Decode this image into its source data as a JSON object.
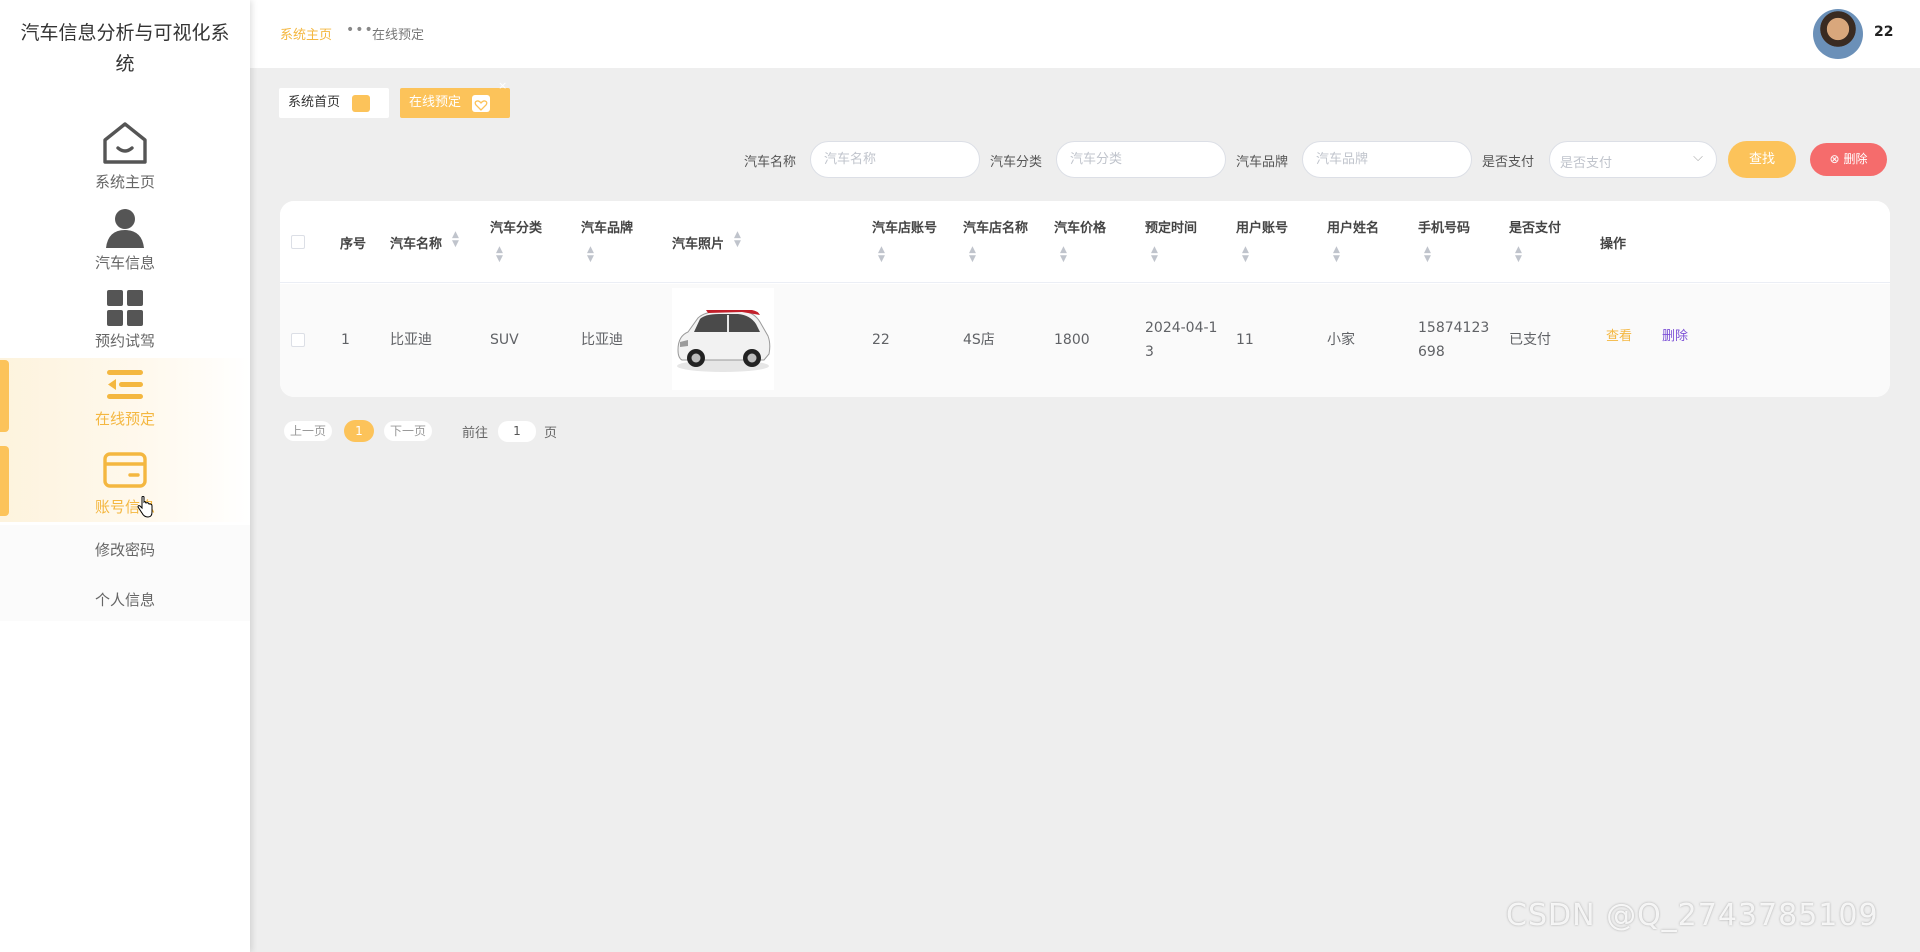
{
  "app": {
    "title": "汽车信息分析与可视化系统"
  },
  "sidebar": {
    "items": [
      {
        "label": "系统主页",
        "icon": "home-icon",
        "active": false
      },
      {
        "label": "汽车信息",
        "icon": "user-icon",
        "active": false
      },
      {
        "label": "预约试驾",
        "icon": "grid-icon",
        "active": false
      },
      {
        "label": "在线预定",
        "icon": "list-indent-icon",
        "active": true
      },
      {
        "label": "账号信息",
        "icon": "card-icon",
        "active": true
      }
    ],
    "submenu": [
      {
        "label": "修改密码"
      },
      {
        "label": "个人信息"
      }
    ]
  },
  "header": {
    "breadcrumb_home": "系统主页",
    "breadcrumb_current": "在线预定",
    "username": "22"
  },
  "tabs": [
    {
      "label": "系统首页"
    },
    {
      "label": "在线预定",
      "close": "×"
    }
  ],
  "search": {
    "fields": [
      {
        "label": "汽车名称",
        "placeholder": "汽车名称"
      },
      {
        "label": "汽车分类",
        "placeholder": "汽车分类"
      },
      {
        "label": "汽车品牌",
        "placeholder": "汽车品牌"
      }
    ],
    "pay_label": "是否支付",
    "pay_placeholder": "是否支付",
    "find_button": "查找",
    "delete_button": "删除"
  },
  "table": {
    "columns": [
      "序号",
      "汽车名称",
      "汽车分类",
      "汽车品牌",
      "汽车照片",
      "汽车店账号",
      "汽车店名称",
      "汽车价格",
      "预定时间",
      "用户账号",
      "用户姓名",
      "手机号码",
      "是否支付",
      "操作"
    ],
    "rows": [
      {
        "index": "1",
        "car_name": "比亚迪",
        "category": "SUV",
        "brand": "比亚迪",
        "shop_account": "22",
        "shop_name": "4S店",
        "price": "1800",
        "reserve_time_line1": "2024-04-1",
        "reserve_time_line2": "3",
        "user_account": "11",
        "user_name": "小家",
        "phone_line1": "15874123",
        "phone_line2": "698",
        "paid": "已支付",
        "action_view": "查看",
        "action_delete": "删除"
      }
    ]
  },
  "pagination": {
    "prev": "上一页",
    "current_page": "1",
    "next": "下一页",
    "goto_label": "前往",
    "goto_value": "1",
    "page_suffix": "页"
  },
  "watermark": "CSDN @Q_2743785109",
  "colors": {
    "accent": "#fcc35a",
    "danger": "#f56c6c",
    "link_purple": "#7b4fd6"
  }
}
